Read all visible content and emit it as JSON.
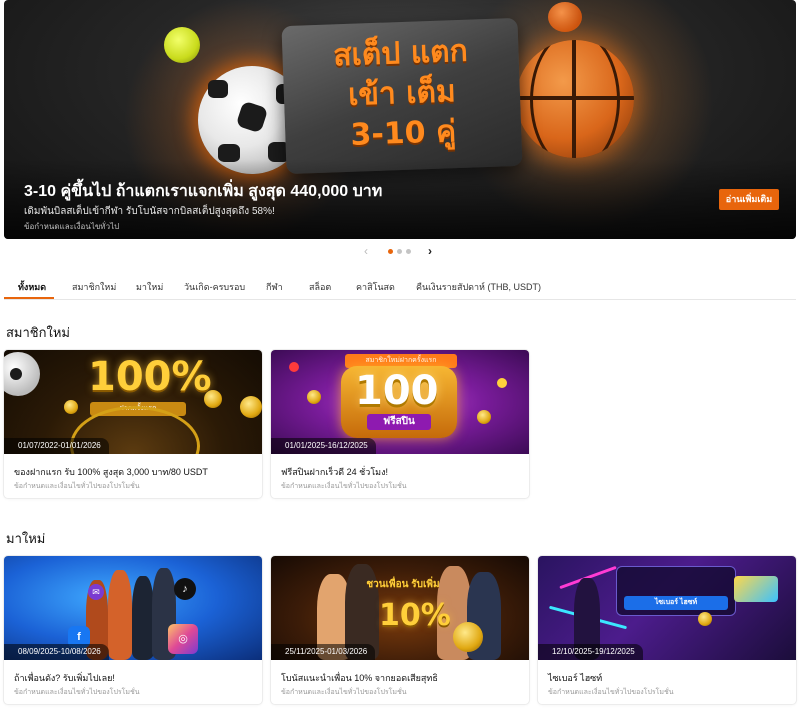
{
  "hero": {
    "title": "สเต็ป แตก\nเข้า เต็ม\n3-10 คู่",
    "headline": "3-10 คู่ขึ้นไป ถ้าแตกเราแจกเพิ่ม สูงสุด 440,000 บาท",
    "subtitle": "เดิมพันบิลสเต็ปเข้ากีฬา รับโบนัสจากบิลสเต็ปสูงสุดถึง 58%!",
    "terms": "ข้อกำหนดและเงื่อนไขทั่วไป",
    "button_label": "อ่านเพิ่มเติม"
  },
  "carousel": {
    "prev_icon": "‹",
    "next_icon": "›",
    "active_index": 0,
    "count": 3
  },
  "tabs": [
    {
      "label": "ทั้งหมด",
      "active": true
    },
    {
      "label": "สมาชิกใหม่"
    },
    {
      "label": "มาใหม่"
    },
    {
      "label": "วันเกิด-ครบรอบ"
    },
    {
      "label": "กีฬา"
    },
    {
      "label": "สล็อต"
    },
    {
      "label": "คาสิโนสด"
    },
    {
      "label": "คืนเงินรายสัปดาห์ (THB, USDT)"
    }
  ],
  "sections": [
    {
      "title": "สมาชิกใหม่",
      "cards": [
        {
          "art_text": "100%",
          "art_ribbon": "ฝากครั้งแรก",
          "date": "01/07/2022-01/01/2026",
          "title": "ของฝากแรก รับ 100% สูงสุด 3,000 บาท/80 USDT",
          "desc": "ข้อกำหนดและเงื่อนไขทั่วไปของโปรโมชั่น"
        },
        {
          "art_text": "100",
          "art_sub": "ฟรีสปิน",
          "art_ribbon": "สมาชิกใหม่ฝากครั้งแรก",
          "date": "01/01/2025-16/12/2025",
          "title": "ฟรีสปินฝากเร็วดี 24 ชั่วโมง!",
          "desc": "ข้อกำหนดและเงื่อนไขทั่วไปของโปรโมชั่น"
        }
      ]
    },
    {
      "title": "มาใหม่",
      "cards": [
        {
          "date": "08/09/2025-10/08/2026",
          "title": "ถ้าเพื่อนดัง? รับเพิ่มไปเลย!",
          "desc": "ข้อกำหนดและเงื่อนไขทั่วไปของโปรโมชั่น"
        },
        {
          "art_text": "10%",
          "art_ribbon": "ชวนเพื่อน รับเพิ่ม",
          "date": "25/11/2025-01/03/2026",
          "title": "โบนัสแนะนำเพื่อน 10% จากยอดเสียสุทธิ",
          "desc": "ข้อกำหนดและเงื่อนไขทั่วไปของโปรโมชั่น"
        },
        {
          "art_ribbon": "ไซเบอร์ ไฮซท์",
          "date": "12/10/2025-19/12/2025",
          "title": "ไซเบอร์ ไฮซท์",
          "desc": "ข้อกำหนดและเงื่อนไขทั่วไปของโปรโมชั่น"
        }
      ]
    }
  ],
  "colors": {
    "accent": "#e8650c",
    "text": "#111111",
    "muted": "#9a9a9a"
  }
}
